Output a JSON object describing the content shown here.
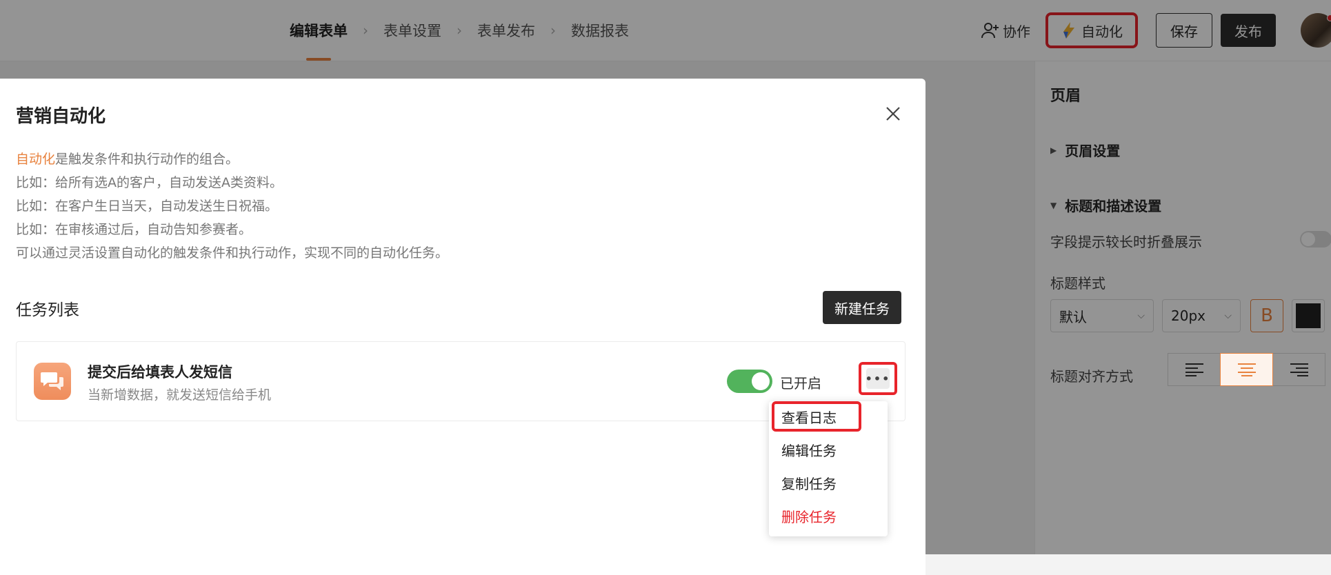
{
  "topbar": {
    "steps": [
      {
        "label": "编辑表单"
      },
      {
        "label": "表单设置"
      },
      {
        "label": "表单发布"
      },
      {
        "label": "数据报表"
      }
    ],
    "collab_label": "协作",
    "automation_label": "自动化",
    "save_label": "保存",
    "publish_label": "发布"
  },
  "panel": {
    "title": "页眉",
    "section_header": "页眉设置",
    "section_title_desc": "标题和描述设置",
    "fold_label": "字段提示较长时折叠展示",
    "title_style_label": "标题样式",
    "style_select": "默认",
    "size_select": "20px",
    "bold_label": "B",
    "align_label": "标题对齐方式"
  },
  "modal": {
    "title": "营销自动化",
    "desc_highlight": "自动化",
    "desc_line1_rest": "是触发条件和执行动作的组合。",
    "desc_line2": "比如：给所有选A的客户，自动发送A类资料。",
    "desc_line3": "比如：在客户生日当天，自动发送生日祝福。",
    "desc_line4": "比如：在审核通过后，自动告知参赛者。",
    "desc_line5": "可以通过灵活设置自动化的触发条件和执行动作，实现不同的自动化任务。",
    "tasks_title": "任务列表",
    "new_task_label": "新建任务",
    "task": {
      "name": "提交后给填表人发短信",
      "description": "当新增数据，就发送短信给手机",
      "status_label": "已开启",
      "more_label": "•••"
    },
    "menu": {
      "view_log": "查看日志",
      "edit_task": "编辑任务",
      "copy_task": "复制任务",
      "delete_task": "删除任务"
    }
  },
  "colors": {
    "accent": "#e8823e",
    "highlight_border": "#e8242b",
    "switch_on": "#52b35c"
  }
}
